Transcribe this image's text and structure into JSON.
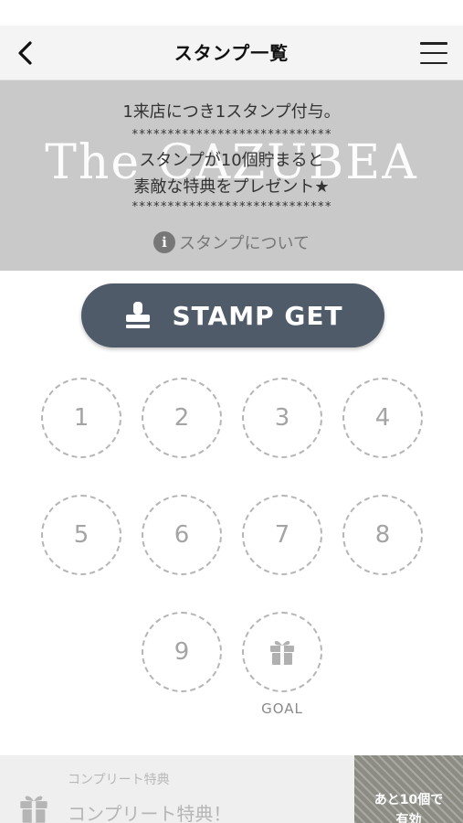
{
  "header": {
    "title": "スタンプ一覧",
    "back_icon": "chevron-left-icon",
    "menu_icon": "hamburger-menu-icon"
  },
  "banner": {
    "line1": "1来店につき1スタンプ付与。",
    "stars1": "****************************",
    "line2": "スタンプが10個貯まると",
    "line3": "素敵な特典をプレゼント★",
    "stars2": "****************************",
    "background_logo": "The CAZUBEA",
    "info_link": "スタンプについて",
    "info_icon": "info-icon"
  },
  "stamp_button": {
    "label": "STAMP GET",
    "icon": "stamp-icon",
    "color": "#4f5b68"
  },
  "stamps": {
    "slots": [
      "1",
      "2",
      "3",
      "4",
      "5",
      "6",
      "7",
      "8",
      "9"
    ],
    "goal_label": "GOAL",
    "goal_icon": "gift-icon"
  },
  "complete": {
    "caption": "コンプリート特典",
    "title": "コンプリート特典！",
    "icon": "gift-icon",
    "remaining_line1": "あと10個で",
    "remaining_line2": "有効"
  }
}
